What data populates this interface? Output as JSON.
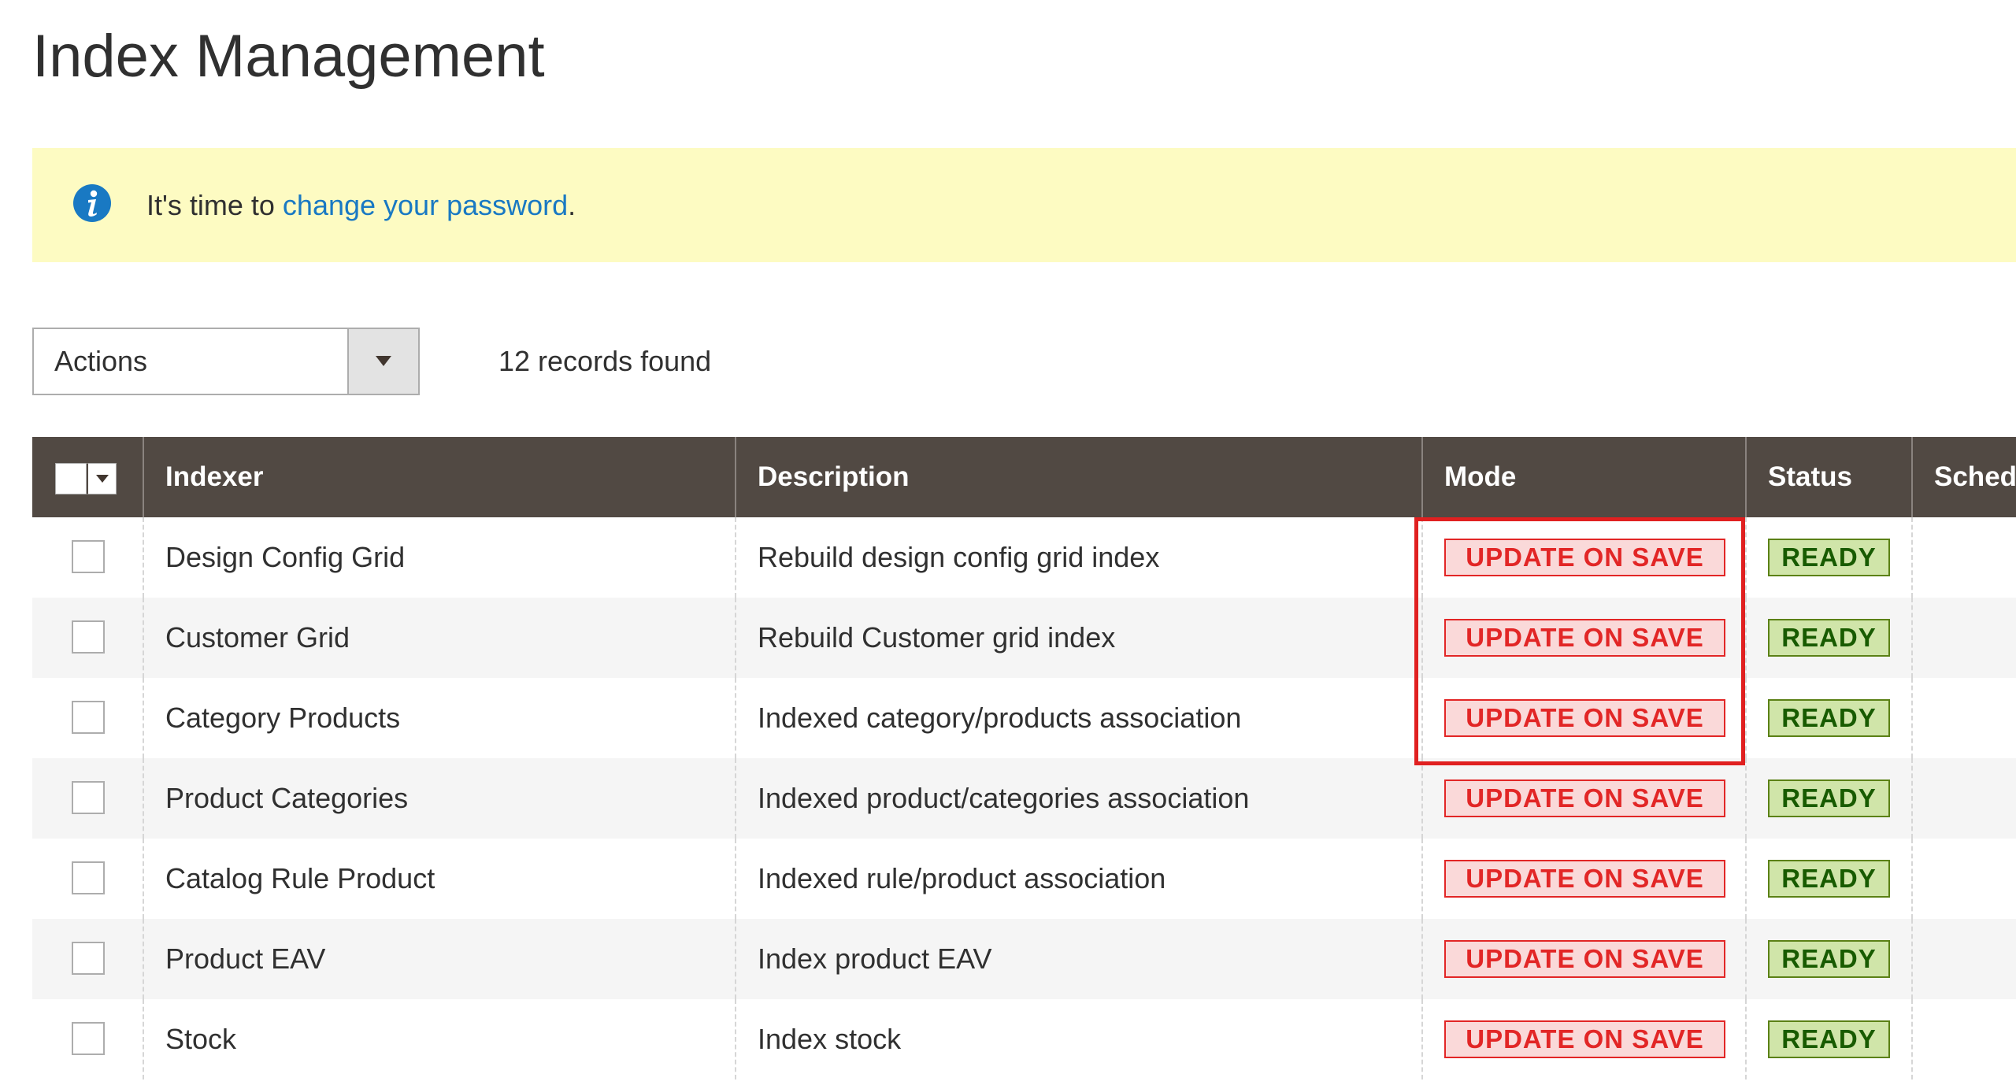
{
  "page": {
    "title": "Index Management"
  },
  "notice": {
    "icon": "info-icon",
    "prefix": "It's time to ",
    "link_text": "change your password",
    "suffix": ".",
    "background": "#fdfbc2",
    "link_color": "#1979c3"
  },
  "toolbar": {
    "actions_label": "Actions",
    "records_found": "12 records found"
  },
  "grid": {
    "columns": [
      "Indexer",
      "Description",
      "Mode",
      "Status",
      "Schedu"
    ],
    "rows": [
      {
        "indexer": "Design Config Grid",
        "description": "Rebuild design config grid index",
        "mode": "UPDATE ON SAVE",
        "status": "READY"
      },
      {
        "indexer": "Customer Grid",
        "description": "Rebuild Customer grid index",
        "mode": "UPDATE ON SAVE",
        "status": "READY"
      },
      {
        "indexer": "Category Products",
        "description": "Indexed category/products association",
        "mode": "UPDATE ON SAVE",
        "status": "READY"
      },
      {
        "indexer": "Product Categories",
        "description": "Indexed product/categories association",
        "mode": "UPDATE ON SAVE",
        "status": "READY"
      },
      {
        "indexer": "Catalog Rule Product",
        "description": "Indexed rule/product association",
        "mode": "UPDATE ON SAVE",
        "status": "READY"
      },
      {
        "indexer": "Product EAV",
        "description": "Index product EAV",
        "mode": "UPDATE ON SAVE",
        "status": "READY"
      },
      {
        "indexer": "Stock",
        "description": "Index stock",
        "mode": "UPDATE ON SAVE",
        "status": "READY"
      }
    ],
    "colors": {
      "header_bg": "#514943",
      "mode_badge_bg": "#fad9d9",
      "mode_badge_text": "#e22626",
      "status_badge_bg": "#d0e5a9",
      "status_badge_text": "#185b00",
      "highlight_border": "#e02020"
    }
  }
}
